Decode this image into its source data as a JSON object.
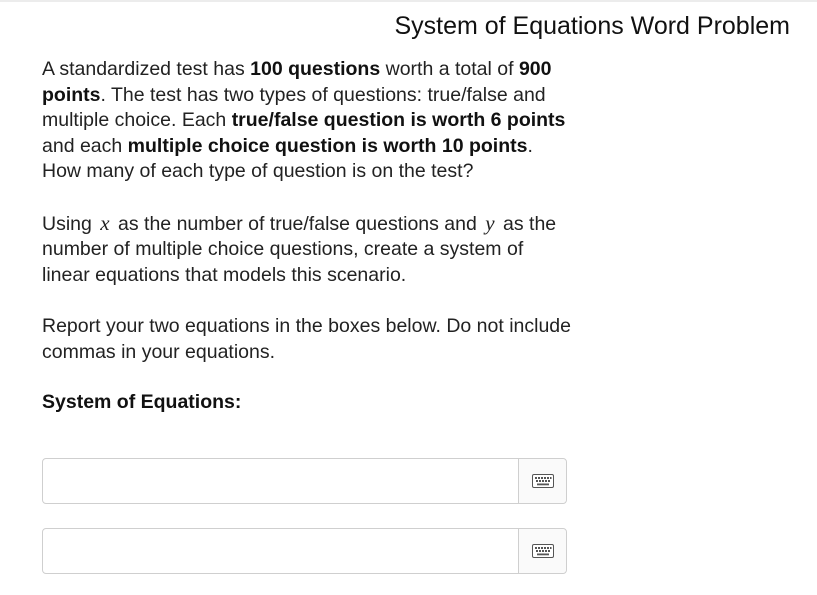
{
  "header": {
    "title": "System of Equations Word Problem"
  },
  "problem": {
    "p1": [
      {
        "text": "A standardized test has ",
        "bold": false
      },
      {
        "text": "100 questions",
        "bold": true
      },
      {
        "text": " worth a total of ",
        "bold": false
      },
      {
        "text": "900 points",
        "bold": true
      },
      {
        "text": ". The test has two types of questions: true/false and multiple choice. Each ",
        "bold": false
      },
      {
        "text": "true/false question is worth 6 points",
        "bold": true
      },
      {
        "text": " and each ",
        "bold": false
      },
      {
        "text": "multiple choice question is worth 10 points",
        "bold": true
      },
      {
        "text": ". How many of each type of question is on the test?",
        "bold": false
      }
    ],
    "p2": {
      "before_x": "Using",
      "var_x": "x",
      "between": "as the number of true/false questions and",
      "var_y": "y",
      "after_y": "as the number of multiple choice questions, create a system of linear equations that models this scenario."
    },
    "p3": "Report your two equations in the boxes below. Do not include commas in your equations."
  },
  "answer": {
    "section_label": "System of Equations:",
    "inputs": [
      {
        "value": "",
        "placeholder": ""
      },
      {
        "value": "",
        "placeholder": ""
      }
    ],
    "keyboard_icon": "keyboard-icon"
  }
}
